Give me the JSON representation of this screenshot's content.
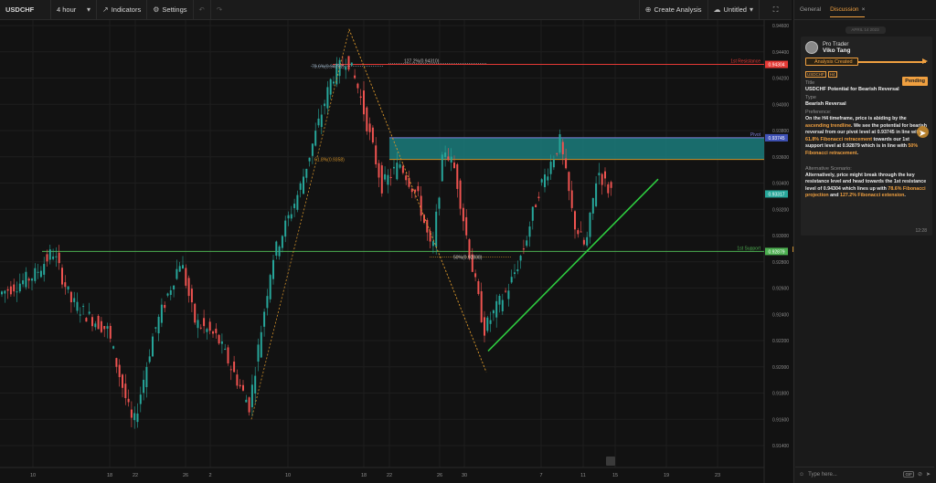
{
  "toolbar": {
    "symbol": "USDCHF",
    "interval": "4 hour",
    "indicators": "Indicators",
    "settings": "Settings",
    "create_analysis": "Create Analysis",
    "layout_name": "Untitled"
  },
  "chart": {
    "price_labels": [
      "0.94600",
      "0.94400",
      "0.94200",
      "0.94000",
      "0.93800",
      "0.93600",
      "0.93400",
      "0.93200",
      "0.93000",
      "0.92800",
      "0.92600",
      "0.92400",
      "0.92200",
      "0.92000",
      "0.91800",
      "0.91600",
      "0.91400"
    ],
    "date_labels": [
      "10",
      "18",
      "22",
      "26",
      "2",
      "10",
      "18",
      "22",
      "26",
      "30",
      "7",
      "11",
      "15",
      "19",
      "23"
    ],
    "level_labels": {
      "resistance": "1st Resistance",
      "resistance_price": "0.94304",
      "pivot": "Pivot",
      "pivot_price": "0.93745",
      "support": "1st Support",
      "support_price": "0.92879",
      "current_price": "0.93317",
      "fib_786": "78.6%(0.94291)",
      "fib_1272": "127.2%(0.94310)",
      "fib_618": "61.8%(0.9358)",
      "fib_50": "50%(0.92838)"
    },
    "colors": {
      "bull": "#26a69a",
      "bear": "#ef5350",
      "resistance": "#e53935",
      "support": "#4caf50",
      "pivot_zone": "#1b7c7c",
      "trend": "#2ecc40",
      "fib": "#d0902a"
    }
  },
  "panel": {
    "tabs": [
      "General",
      "Discussion"
    ],
    "date_pill": "APRIL 14 2023",
    "author_role": "Pro Trader",
    "author_name": "Viko Tang",
    "status": "Analysis Created",
    "chip_symbol": "USDCHF",
    "chip_interval": "H4",
    "pending": "Pending",
    "title_label": "Title",
    "title_value": "USDCHF Potential for Bearish Reversal",
    "type_label": "Type",
    "type_value": "Bearish Reversal",
    "preference_label": "Preference:",
    "preference_1": "On the H4 timeframe, price is abiding by the",
    "preference_hl_1": "ascending trendline",
    "preference_2": ". We see the potential for bearish reversal from our pivot level at 0.93745 in line with",
    "preference_hl_2": "61.8% Fibonacci retracement",
    "preference_3": "towards our 1st support level at 0.92879 which is in line with",
    "preference_hl_3": "50% Fibonacci retracement",
    "preference_4": ".",
    "alt_label": "Alternative Scenario:",
    "alt_1": "Alternatively, price might break through the key resistance level and head towards the 1st resistance level of 0.94304 which lines up with",
    "alt_hl_1": "78.6% Fibonacci projection",
    "alt_2": "and",
    "alt_hl_2": "127.2% Fibonacci extension",
    "alt_3": ".",
    "time": "12:28",
    "reply_placeholder": "Type here...",
    "gif": "GIF"
  }
}
